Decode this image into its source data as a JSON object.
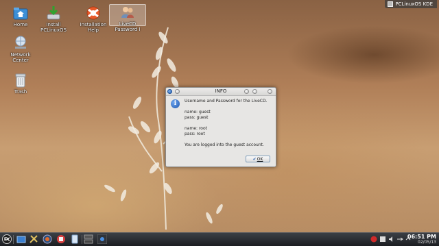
{
  "desktop": {
    "icons": [
      {
        "label": "Home"
      },
      {
        "label": "Install PCLinuxOS"
      },
      {
        "label": "Installation Help"
      },
      {
        "label": "LiveCD Password I"
      },
      {
        "label": "Network Center"
      },
      {
        "label": "Trash"
      }
    ],
    "badge": "PCLinuxOS KDE"
  },
  "dialog": {
    "title": "INFO",
    "lines": [
      "Username and Password for the LiveCD.",
      "name: guest",
      "pass: guest",
      "name: root",
      "pass: root",
      "You are logged into the guest account."
    ],
    "ok_label": "OK",
    "ok_mnemonic": "O"
  },
  "taskbar": {
    "clock_time": "06:51 PM",
    "clock_date": "02/05/13"
  },
  "colors": {
    "accent": "#2a62b3",
    "taskbar": "#2a2d32"
  }
}
